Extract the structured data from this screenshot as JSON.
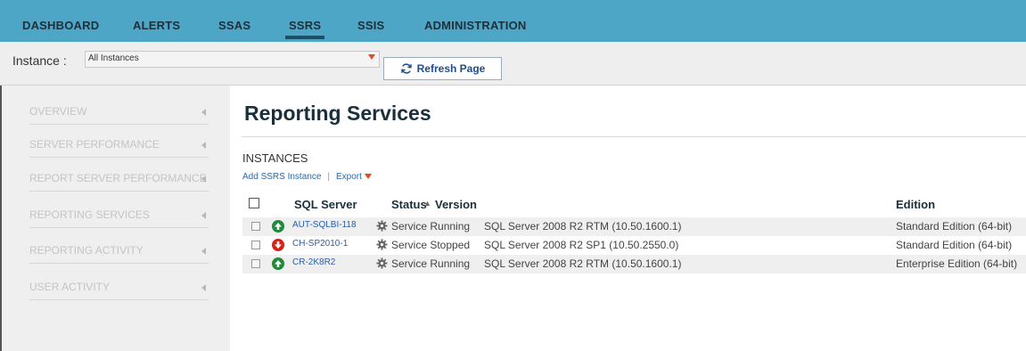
{
  "nav": {
    "tabs": [
      {
        "label": "DASHBOARD"
      },
      {
        "label": "ALERTS"
      },
      {
        "label": "SSAS"
      },
      {
        "label": "SSRS",
        "active": true
      },
      {
        "label": "SSIS"
      },
      {
        "label": "ADMINISTRATION"
      }
    ]
  },
  "instance_bar": {
    "label": "Instance :",
    "selected": "All Instances",
    "refresh_label": "Refresh Page"
  },
  "sidebar": {
    "items": [
      {
        "label": "Overview"
      },
      {
        "label": "Server Performance"
      },
      {
        "label": "Report Server Performance"
      },
      {
        "label": "Reporting Services"
      },
      {
        "label": "Reporting Activity"
      },
      {
        "label": "User Activity"
      }
    ]
  },
  "main": {
    "title": "Reporting Services",
    "section": "INSTANCES",
    "add_link": "Add SSRS Instance",
    "separator": "|",
    "export_link": "Export",
    "columns": {
      "server": "SQL Server",
      "status": "Status",
      "version": "Version",
      "edition": "Edition"
    },
    "rows": [
      {
        "server": "AUT-SQLBI-118",
        "state": "up",
        "status": "Service Running",
        "version": "SQL Server 2008 R2 RTM (10.50.1600.1)",
        "edition": "Standard Edition (64-bit)"
      },
      {
        "server": "CH-SP2010-1",
        "state": "down",
        "status": "Service Stopped",
        "version": "SQL Server 2008 R2 SP1 (10.50.2550.0)",
        "edition": "Standard Edition (64-bit)"
      },
      {
        "server": "CR-2K8R2",
        "state": "up",
        "status": "Service Running",
        "version": "SQL Server 2008 R2 RTM (10.50.1600.1)",
        "edition": "Enterprise Edition (64-bit)"
      }
    ]
  },
  "colors": {
    "nav_bg": "#4ea6c7",
    "running": "#1e8a3a",
    "stopped": "#d4221b",
    "accent_caret": "#e8471b",
    "link": "#2b5fa6"
  }
}
